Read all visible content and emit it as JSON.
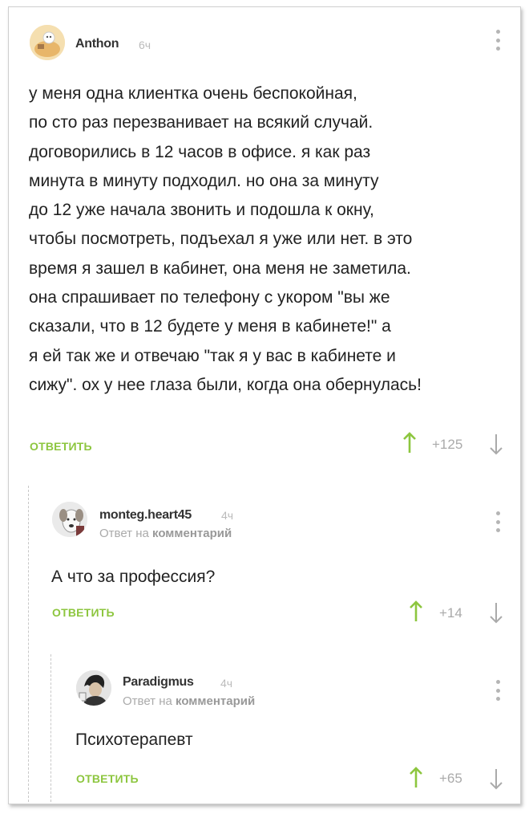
{
  "comments": [
    {
      "username": "Anthon",
      "time": "6ч",
      "text_lines": [
        "у меня одна клиентка очень беспокойная,",
        "по сто раз перезванивает на всякий случай.",
        "договорились в 12 часов в офисе. я как раз",
        "минута в минуту подходил. но она за минуту",
        "до 12 уже начала звонить и подошла к окну,",
        "чтобы посмотреть, подъехал я уже или нет. в это",
        "время я зашел в кабинет, она меня не заметила.",
        "она спрашивает по телефону с укором \"вы же",
        "сказали, что в 12 будете у меня в кабинете!\" а",
        "я ей так же и отвечаю \"так я у вас в кабинете и",
        "сижу\". ох у нее глаза были, когда она обернулась!"
      ],
      "reply_label": "ОТВЕТИТЬ",
      "rating": "+125"
    },
    {
      "username": "monteg.heart45",
      "time": "4ч",
      "reply_prefix": "Ответ на",
      "reply_target": "комментарий",
      "text": "А что за профессия?",
      "reply_label": "ОТВЕТИТЬ",
      "rating": "+14"
    },
    {
      "username": "Paradigmus",
      "time": "4ч",
      "reply_prefix": "Ответ на",
      "reply_target": "комментарий",
      "text": "Психотерапевт",
      "reply_label": "ОТВЕТИТЬ",
      "rating": "+65"
    }
  ],
  "colors": {
    "accent_green": "#8dc63f",
    "muted": "#aaaaaa",
    "text": "#222222"
  },
  "icons": [
    "avatar-cat-icon",
    "menu-dots-icon",
    "arrow-up-icon",
    "arrow-down-icon"
  ]
}
